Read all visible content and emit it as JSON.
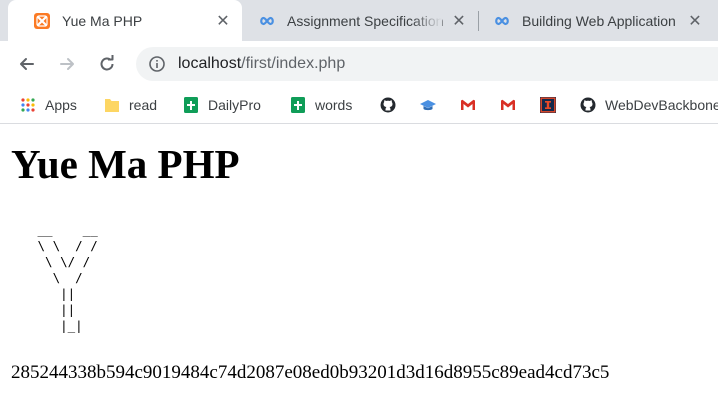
{
  "tabs": [
    {
      "title": "Yue Ma PHP",
      "icon": "xampp-icon",
      "active": true
    },
    {
      "title": "Assignment Specification",
      "icon": "infinity-icon",
      "active": false
    },
    {
      "title": "Building Web Application",
      "icon": "infinity-icon",
      "active": false
    }
  ],
  "toolbar": {
    "url_host": "localhost",
    "url_path": "/first/index.php"
  },
  "bookmarks": [
    {
      "label": "Apps",
      "icon": "apps-grid-icon"
    },
    {
      "label": "read",
      "icon": "folder-icon"
    },
    {
      "label": "DailyPro",
      "icon": "google-sheets-icon"
    },
    {
      "label": "words",
      "icon": "google-sheets-icon"
    },
    {
      "label": "",
      "icon": "github-icon"
    },
    {
      "label": "",
      "icon": "graduation-cap-icon"
    },
    {
      "label": "",
      "icon": "gmail-icon"
    },
    {
      "label": "",
      "icon": "gmail-icon"
    },
    {
      "label": "",
      "icon": "illinois-icon"
    },
    {
      "label": "WebDevBackbone",
      "icon": "github-icon"
    }
  ],
  "page": {
    "title": "Yue Ma PHP",
    "ascii_art": " __    __\n \\ \\  / /\n  \\ \\/ /\n   \\  /\n    ||\n    ||\n    |_|",
    "hash": "285244338b594c9019484c74d2087e08ed0b93201d3d16d8955c89ead4cd73c5"
  },
  "colors": {
    "tabstrip": "#dee1e6",
    "xampp_orange": "#fb7a24",
    "infinity_blue": "#4a90e2",
    "sheets_green": "#0f9d58",
    "folder_yellow": "#fdd663"
  }
}
